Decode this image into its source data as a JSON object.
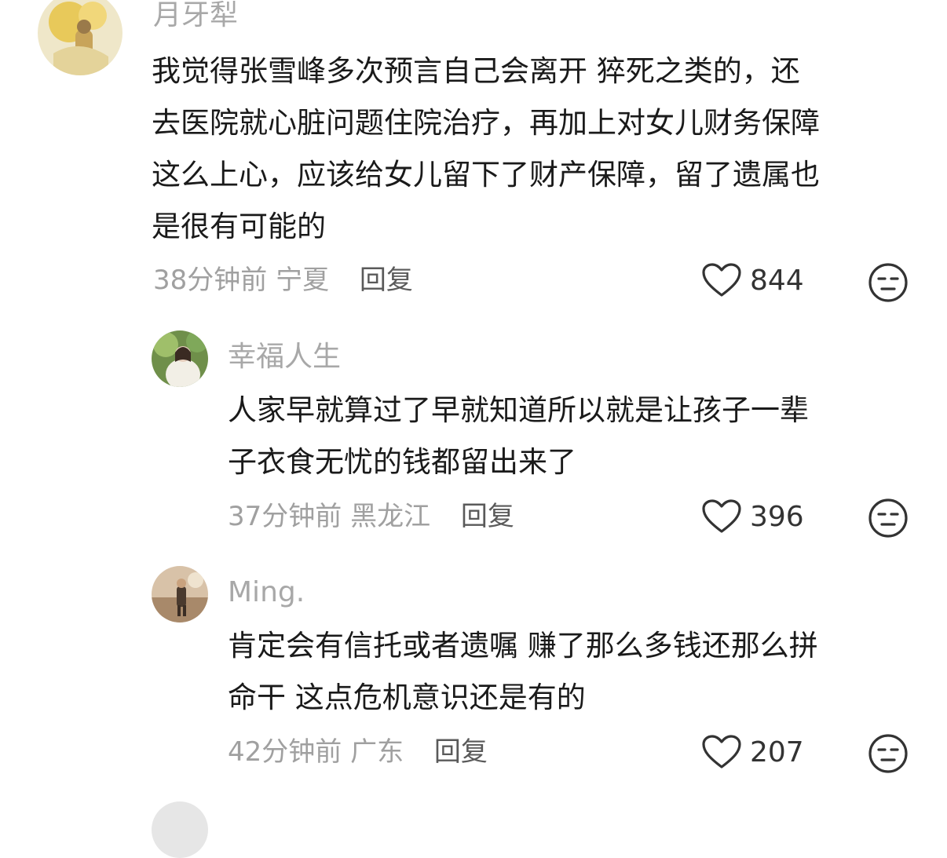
{
  "comments": [
    {
      "username": "月牙犁",
      "lines": [
        "我觉得张雪峰多次预言自己会离开 猝死之类的，还",
        "去医院就心脏问题住院治疗，再加上对女儿财务保障",
        "这么上心，应该给女儿留下了财产保障，留了遗属也",
        "是很有可能的"
      ],
      "time": "38分钟前",
      "location": "宁夏",
      "reply_label": "回复",
      "likes": "844"
    },
    {
      "username": "幸福人生",
      "lines": [
        "人家早就算过了早就知道所以就是让孩子一辈",
        "子衣食无忧的钱都留出来了"
      ],
      "time": "37分钟前",
      "location": "黑龙江",
      "reply_label": "回复",
      "likes": "396"
    },
    {
      "username": "Ming.",
      "lines": [
        "肯定会有信托或者遗嘱 赚了那么多钱还那么拼",
        "命干 这点危机意识还是有的"
      ],
      "time": "42分钟前",
      "location": "广东",
      "reply_label": "回复",
      "likes": "207"
    }
  ],
  "icons": {
    "like": "heart-outline-icon",
    "dislike": "unamused-face-icon"
  },
  "colors": {
    "secondary_text": "#a8a8a8",
    "primary_text": "#1a1a1a",
    "icon": "#333333"
  }
}
